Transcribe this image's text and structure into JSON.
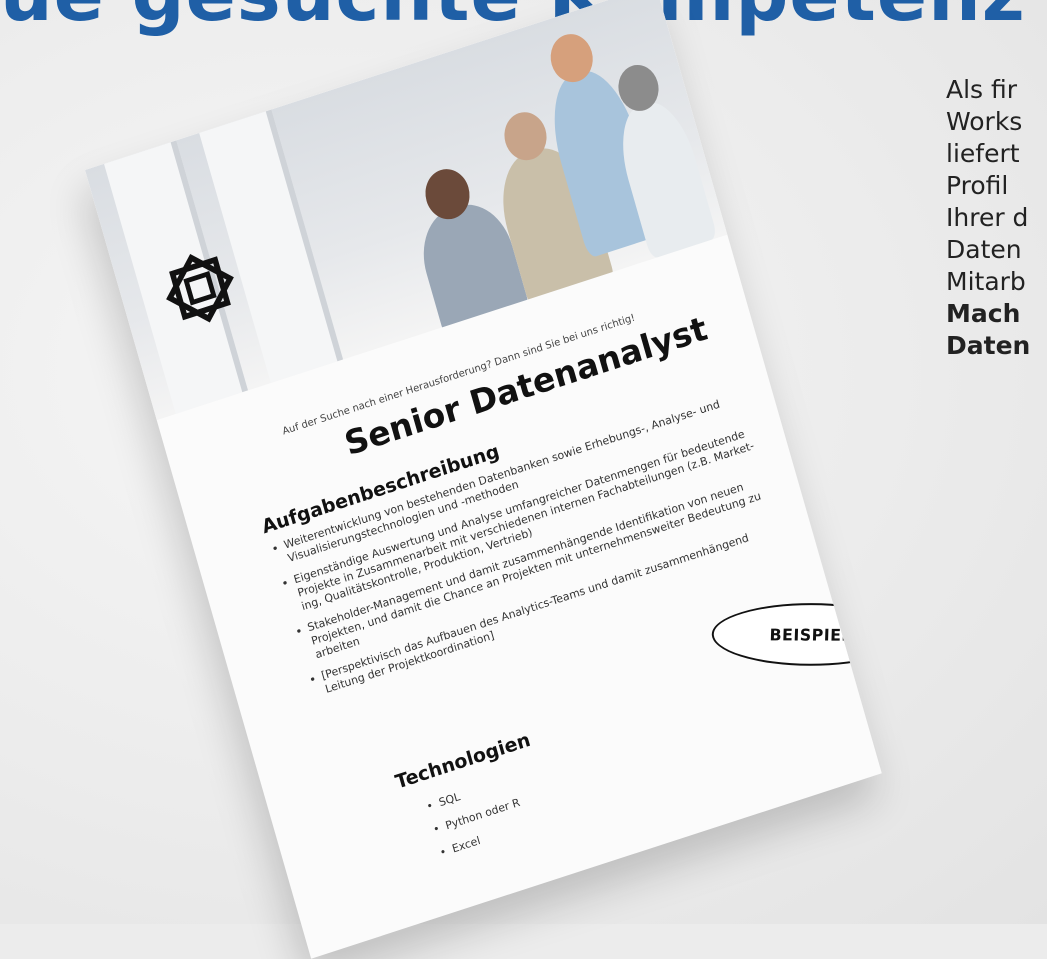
{
  "header": {
    "fragment": "ue gesuchte Kompetenz"
  },
  "side_text": {
    "lines": [
      "Als fir",
      "Works",
      "liefert",
      "Profil",
      "Ihrer d",
      "Daten",
      "Mitarb"
    ],
    "bold_lines": [
      "Mach",
      "Daten"
    ]
  },
  "job": {
    "tagline": "Auf der Suche nach einer Herausforderung? Dann sind Sie bei uns richtig!",
    "title": "Senior Datenanalyst",
    "tasks_heading": "Aufgabenbeschreibung",
    "tasks": [
      {
        "lines": [
          "Weiterentwicklung von bestehenden Datenbanken sowie Erhebungs-, Analyse- und",
          "Visualisierungstechnologien und -methoden"
        ]
      },
      {
        "lines": [
          "Eigenständige Auswertung und Analyse umfangreicher Datenmengen für bedeutende",
          "Projekte in Zusammenarbeit mit verschiedenen internen Fachabteilungen (z.B. Market-",
          "ing, Qualitätskontrolle, Produktion, Vertrieb)"
        ]
      },
      {
        "lines": [
          "Stakeholder-Management und damit zusammenhängende Identifikation von neuen",
          "Projekten, und damit die Chance an Projekten mit unternehmensweiter Bedeutung zu",
          "arbeiten"
        ]
      },
      {
        "lines": [
          "[Perspektivisch das Aufbauen des Analytics-Teams und damit zusammenhängend",
          "Leitung der Projektkoordination]"
        ]
      }
    ],
    "tech_heading": "Technologien",
    "technologies": [
      "SQL",
      "Python oder R",
      "Excel"
    ]
  },
  "badge": {
    "label": "BEISPIEL"
  }
}
